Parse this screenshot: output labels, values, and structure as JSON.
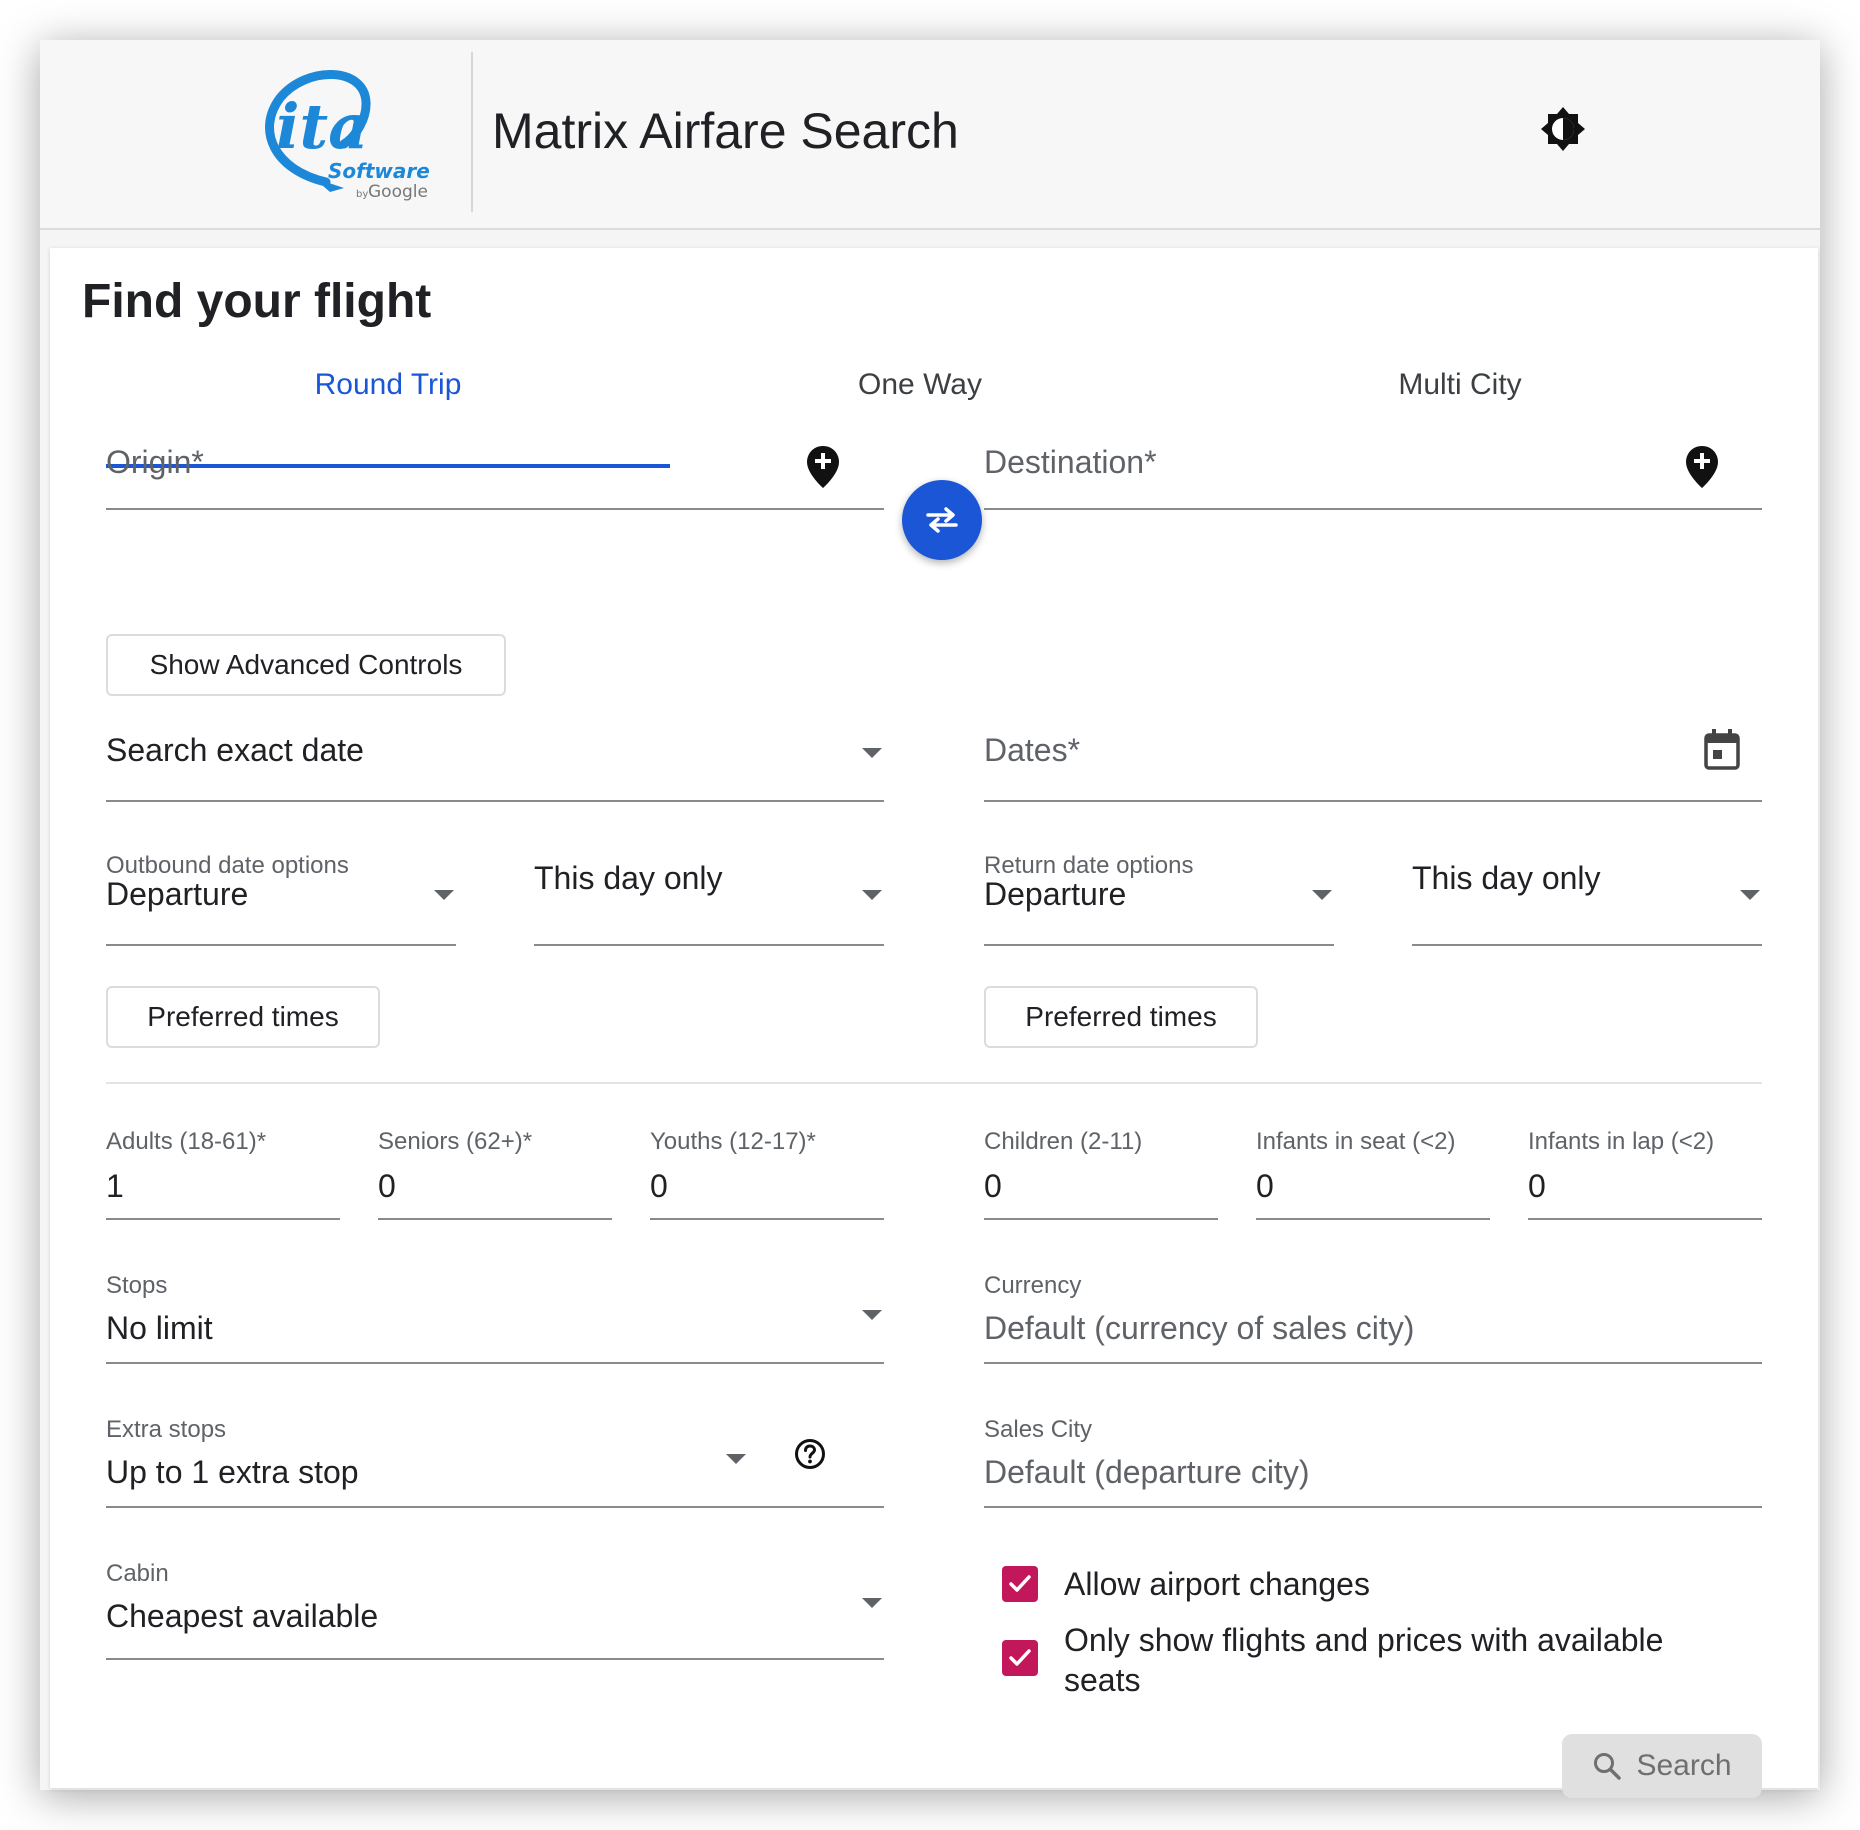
{
  "header": {
    "title": "Matrix Airfare Search",
    "logo": {
      "main": "ita",
      "sub": "Software",
      "by": "by",
      "google": "Google"
    },
    "theme_icon": "brightness-icon"
  },
  "card": {
    "title": "Find your flight",
    "tabs": [
      {
        "label": "Round Trip",
        "active": true
      },
      {
        "label": "One Way",
        "active": false
      },
      {
        "label": "Multi City",
        "active": false
      }
    ],
    "origin": {
      "placeholder": "Origin*",
      "icon": "add-location-icon"
    },
    "destination": {
      "placeholder": "Destination*",
      "icon": "add-location-icon"
    },
    "swap_icon": "swap-icon",
    "advanced_button": "Show Advanced Controls",
    "date_mode": {
      "value": "Search exact date"
    },
    "dates": {
      "placeholder": "Dates*",
      "icon": "calendar-icon"
    },
    "outbound": {
      "label": "Outbound date options",
      "type": "Departure",
      "range": "This day only",
      "preferred_button": "Preferred times"
    },
    "return": {
      "label": "Return date options",
      "type": "Departure",
      "range": "This day only",
      "preferred_button": "Preferred times"
    },
    "passengers": [
      {
        "label": "Adults (18-61)*",
        "value": "1"
      },
      {
        "label": "Seniors (62+)*",
        "value": "0"
      },
      {
        "label": "Youths (12-17)*",
        "value": "0"
      },
      {
        "label": "Children (2-11)",
        "value": "0"
      },
      {
        "label": "Infants in seat (<2)",
        "value": "0"
      },
      {
        "label": "Infants in lap (<2)",
        "value": "0"
      }
    ],
    "stops": {
      "label": "Stops",
      "value": "No limit"
    },
    "currency": {
      "label": "Currency",
      "value": "Default (currency of sales city)"
    },
    "extra_stops": {
      "label": "Extra stops",
      "value": "Up to 1 extra stop",
      "help_icon": "help-icon"
    },
    "sales_city": {
      "label": "Sales City",
      "value": "Default (departure city)"
    },
    "cabin": {
      "label": "Cabin",
      "value": "Cheapest available"
    },
    "checkboxes": [
      {
        "label": "Allow airport changes",
        "checked": true
      },
      {
        "label": "Only show flights and prices with available seats",
        "checked": true
      }
    ],
    "search_button": {
      "label": "Search",
      "icon": "search-icon"
    }
  },
  "colors": {
    "accent": "#1a56d6",
    "checkbox": "#c2185b",
    "logo": "#1e88d8"
  }
}
